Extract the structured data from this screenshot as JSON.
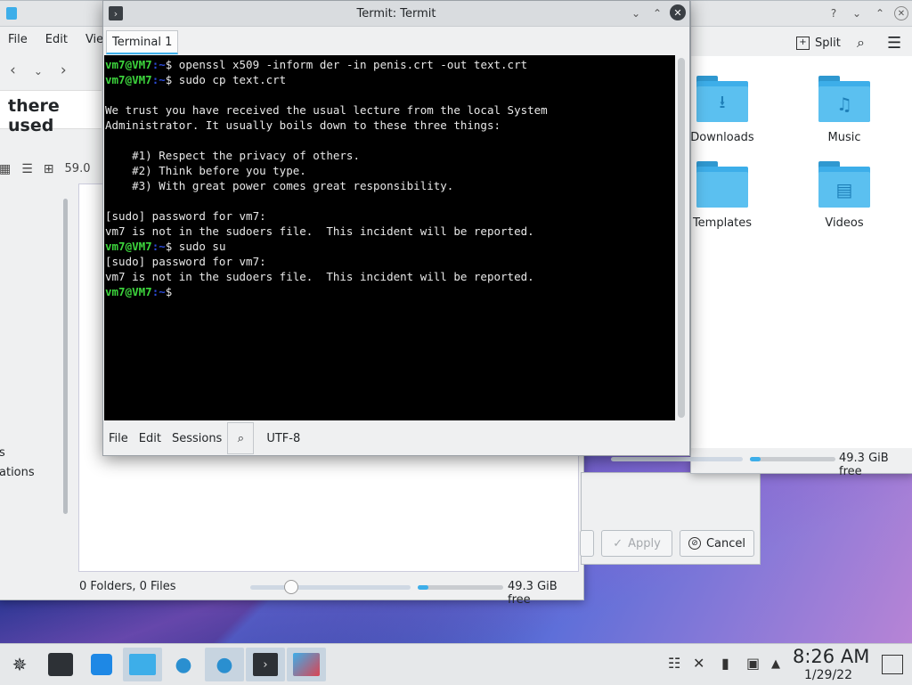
{
  "dolphin_back": {
    "menu": [
      "File",
      "Edit",
      "View"
    ],
    "location_text": "there used",
    "size_text": "59.0",
    "sidebar_fragments": [
      "s",
      "ations"
    ],
    "status": "0 Folders, 0 Files",
    "free": "49.3 GiB free"
  },
  "dolphin_right": {
    "split_label": "Split",
    "folders": [
      "Downloads",
      "Music",
      "Templates",
      "Videos"
    ],
    "free": "49.3 GiB free"
  },
  "dialog": {
    "apply": "Apply",
    "cancel": "Cancel"
  },
  "termit": {
    "title": "Termit: Termit",
    "tab": "Terminal 1",
    "bottom_menu": [
      "File",
      "Edit",
      "Sessions"
    ],
    "encoding": "UTF-8",
    "lines": [
      {
        "prompt": "vm7@VM7",
        "path": ":~",
        "cmd": "$ openssl x509 -inform der -in penis.crt -out text.crt"
      },
      {
        "prompt": "vm7@VM7",
        "path": ":~",
        "cmd": "$ sudo cp text.crt"
      },
      {
        "text": ""
      },
      {
        "text": "We trust you have received the usual lecture from the local System"
      },
      {
        "text": "Administrator. It usually boils down to these three things:"
      },
      {
        "text": ""
      },
      {
        "text": "    #1) Respect the privacy of others."
      },
      {
        "text": "    #2) Think before you type."
      },
      {
        "text": "    #3) With great power comes great responsibility."
      },
      {
        "text": ""
      },
      {
        "text": "[sudo] password for vm7:"
      },
      {
        "text": "vm7 is not in the sudoers file.  This incident will be reported."
      },
      {
        "prompt": "vm7@VM7",
        "path": ":~",
        "cmd": "$ sudo su"
      },
      {
        "text": "[sudo] password for vm7:"
      },
      {
        "text": "vm7 is not in the sudoers file.  This incident will be reported."
      },
      {
        "prompt": "vm7@VM7",
        "path": ":~",
        "cmd": "$ "
      }
    ]
  },
  "taskbar": {
    "time": "8:26 AM",
    "date": "1/29/22"
  }
}
